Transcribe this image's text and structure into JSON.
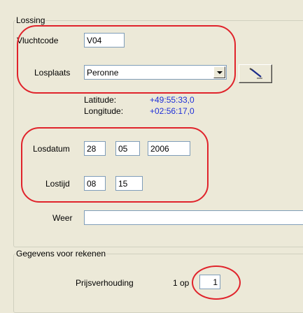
{
  "lossing": {
    "legend": "Lossing",
    "vluchtcode": {
      "label": "Vluchtcode",
      "value": "V04"
    },
    "losplaats": {
      "label": "Losplaats",
      "value": "Peronne"
    },
    "pick_location_icon": "pen-icon",
    "latitude": {
      "label": "Latitude:",
      "value": "+49:55:33,0"
    },
    "longitude": {
      "label": "Longitude:",
      "value": "+02:56:17,0"
    },
    "losdatum": {
      "label": "Losdatum",
      "day": "28",
      "month": "05",
      "year": "2006"
    },
    "lostijd": {
      "label": "Lostijd",
      "hour": "08",
      "minute": "15"
    },
    "weer": {
      "label": "Weer",
      "value": ""
    }
  },
  "rekenen": {
    "legend": "Gegevens voor rekenen",
    "prijsverhouding": {
      "label": "Prijsverhouding",
      "prefix": "1 op",
      "value": "1"
    }
  },
  "colors": {
    "coordinate_text": "#1f2fd8",
    "highlight": "#e0232b",
    "background": "#ece9d8"
  }
}
